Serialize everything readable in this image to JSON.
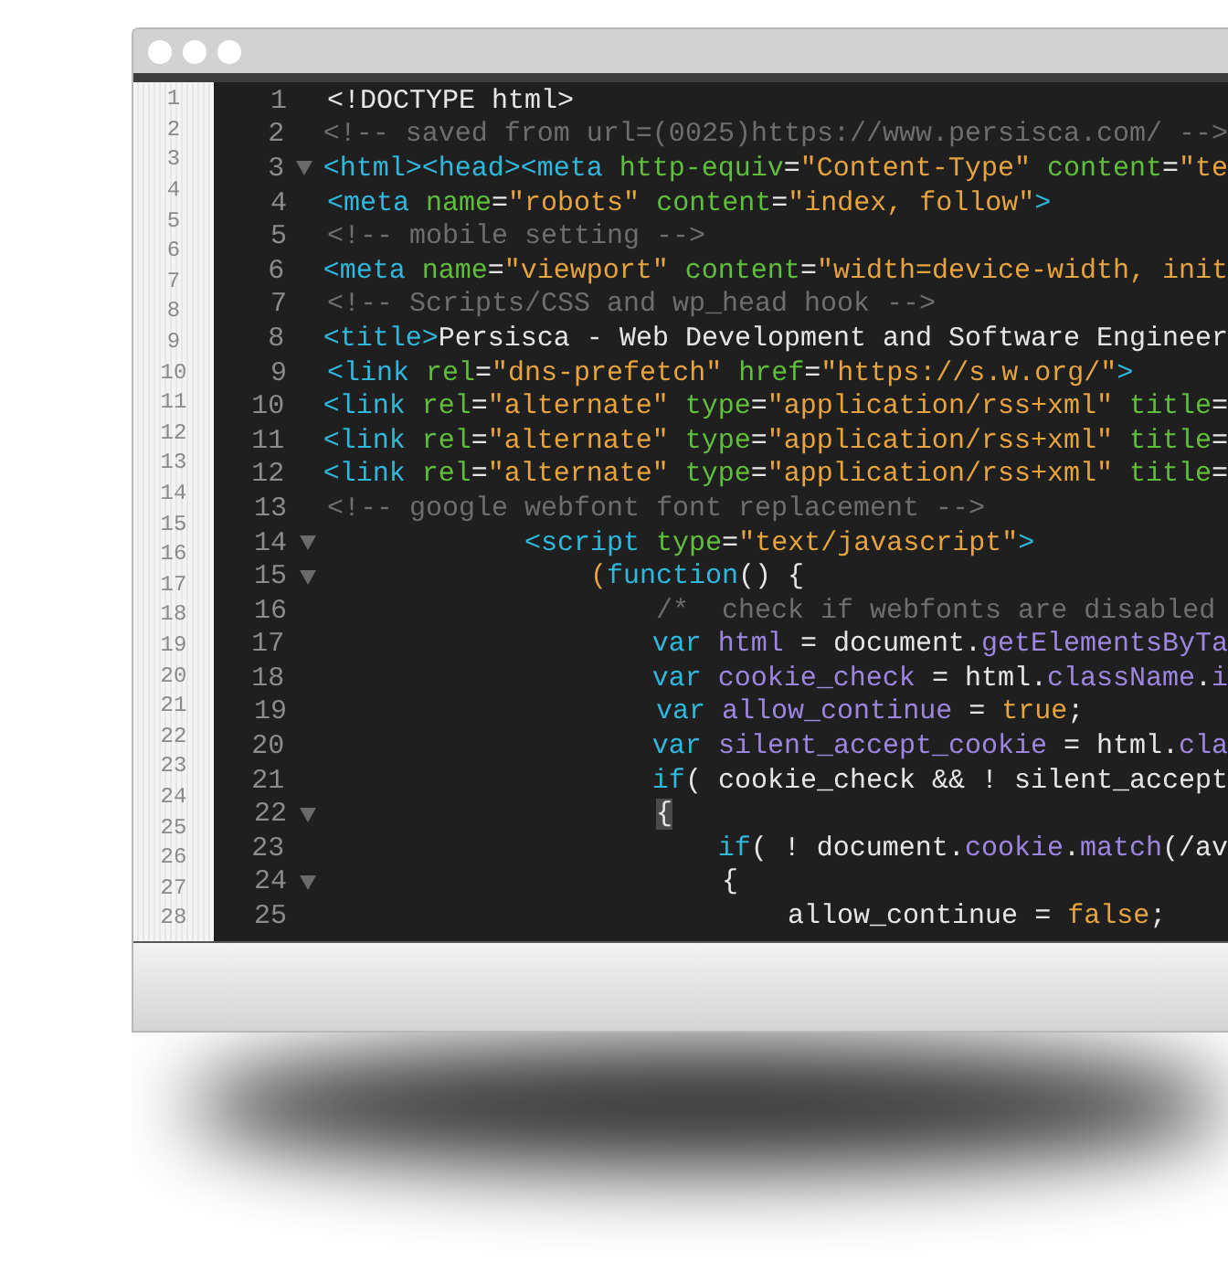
{
  "outer_gutter": {
    "line_numbers": [
      "1",
      "2",
      "3",
      "4",
      "5",
      "6",
      "7",
      "8",
      "9",
      "10",
      "11",
      "12",
      "13",
      "14",
      "15",
      "16",
      "17",
      "18",
      "19",
      "20",
      "21",
      "22",
      "23",
      "24",
      "25",
      "26",
      "27",
      "28"
    ]
  },
  "editor": {
    "lines": [
      {
        "number": "1",
        "foldable": false,
        "tokens": [
          {
            "kind": "text",
            "text": "<!DOCTYPE html>"
          }
        ]
      },
      {
        "number": "2",
        "foldable": false,
        "tokens": [
          {
            "kind": "comment",
            "text": "<!-- saved from url=(0025)https://www.persisca.com/ -->"
          }
        ]
      },
      {
        "number": "3",
        "foldable": true,
        "tokens": [
          {
            "kind": "tag",
            "text": "<html><head><meta "
          },
          {
            "kind": "attr",
            "text": "http-equiv"
          },
          {
            "kind": "text",
            "text": "="
          },
          {
            "kind": "string",
            "text": "\"Content-Type\" "
          },
          {
            "kind": "attr",
            "text": "content"
          },
          {
            "kind": "text",
            "text": "="
          },
          {
            "kind": "string",
            "text": "\"te"
          }
        ]
      },
      {
        "number": "4",
        "foldable": false,
        "tokens": [
          {
            "kind": "tag",
            "text": "<meta "
          },
          {
            "kind": "attr",
            "text": "name"
          },
          {
            "kind": "text",
            "text": "="
          },
          {
            "kind": "string",
            "text": "\"robots\" "
          },
          {
            "kind": "attr",
            "text": "content"
          },
          {
            "kind": "text",
            "text": "="
          },
          {
            "kind": "string",
            "text": "\"index, follow\""
          },
          {
            "kind": "tag",
            "text": ">"
          }
        ]
      },
      {
        "number": "5",
        "foldable": false,
        "tokens": [
          {
            "kind": "comment",
            "text": "<!-- mobile setting -->"
          }
        ]
      },
      {
        "number": "6",
        "foldable": false,
        "tokens": [
          {
            "kind": "tag",
            "text": "<meta "
          },
          {
            "kind": "attr",
            "text": "name"
          },
          {
            "kind": "text",
            "text": "="
          },
          {
            "kind": "string",
            "text": "\"viewport\" "
          },
          {
            "kind": "attr",
            "text": "content"
          },
          {
            "kind": "text",
            "text": "="
          },
          {
            "kind": "string",
            "text": "\"width=device-width, init"
          }
        ]
      },
      {
        "number": "7",
        "foldable": false,
        "tokens": [
          {
            "kind": "comment",
            "text": "<!-- Scripts/CSS and wp_head hook -->"
          }
        ]
      },
      {
        "number": "8",
        "foldable": false,
        "tokens": [
          {
            "kind": "tag",
            "text": "<title>"
          },
          {
            "kind": "text",
            "text": "Persisca - Web Development and Software Engineer"
          }
        ]
      },
      {
        "number": "9",
        "foldable": false,
        "tokens": [
          {
            "kind": "tag",
            "text": "<link "
          },
          {
            "kind": "attr",
            "text": "rel"
          },
          {
            "kind": "text",
            "text": "="
          },
          {
            "kind": "string",
            "text": "\"dns-prefetch\" "
          },
          {
            "kind": "attr",
            "text": "href"
          },
          {
            "kind": "text",
            "text": "="
          },
          {
            "kind": "string",
            "text": "\"https://s.w.org/\""
          },
          {
            "kind": "tag",
            "text": ">"
          }
        ]
      },
      {
        "number": "10",
        "foldable": false,
        "tokens": [
          {
            "kind": "tag",
            "text": "<link "
          },
          {
            "kind": "attr",
            "text": "rel"
          },
          {
            "kind": "text",
            "text": "="
          },
          {
            "kind": "string",
            "text": "\"alternate\" "
          },
          {
            "kind": "attr",
            "text": "type"
          },
          {
            "kind": "text",
            "text": "="
          },
          {
            "kind": "string",
            "text": "\"application/rss+xml\" "
          },
          {
            "kind": "attr",
            "text": "title"
          },
          {
            "kind": "text",
            "text": "="
          }
        ]
      },
      {
        "number": "11",
        "foldable": false,
        "tokens": [
          {
            "kind": "tag",
            "text": "<link "
          },
          {
            "kind": "attr",
            "text": "rel"
          },
          {
            "kind": "text",
            "text": "="
          },
          {
            "kind": "string",
            "text": "\"alternate\" "
          },
          {
            "kind": "attr",
            "text": "type"
          },
          {
            "kind": "text",
            "text": "="
          },
          {
            "kind": "string",
            "text": "\"application/rss+xml\" "
          },
          {
            "kind": "attr",
            "text": "title"
          },
          {
            "kind": "text",
            "text": "="
          }
        ]
      },
      {
        "number": "12",
        "foldable": false,
        "tokens": [
          {
            "kind": "tag",
            "text": "<link "
          },
          {
            "kind": "attr",
            "text": "rel"
          },
          {
            "kind": "text",
            "text": "="
          },
          {
            "kind": "string",
            "text": "\"alternate\" "
          },
          {
            "kind": "attr",
            "text": "type"
          },
          {
            "kind": "text",
            "text": "="
          },
          {
            "kind": "string",
            "text": "\"application/rss+xml\" "
          },
          {
            "kind": "attr",
            "text": "title"
          },
          {
            "kind": "text",
            "text": "="
          }
        ]
      },
      {
        "number": "13",
        "foldable": false,
        "tokens": [
          {
            "kind": "comment",
            "text": "<!-- google webfont font replacement -->"
          }
        ]
      },
      {
        "number": "14",
        "foldable": true,
        "tokens": [
          {
            "kind": "tag",
            "text": "            <script "
          },
          {
            "kind": "attr",
            "text": "type"
          },
          {
            "kind": "text",
            "text": "="
          },
          {
            "kind": "string",
            "text": "\"text/javascript\""
          },
          {
            "kind": "tag",
            "text": ">"
          }
        ]
      },
      {
        "number": "15",
        "foldable": true,
        "tokens": [
          {
            "kind": "string",
            "text": "                ("
          },
          {
            "kind": "keyword",
            "text": "function"
          },
          {
            "kind": "text",
            "text": "() {"
          }
        ]
      },
      {
        "number": "16",
        "foldable": false,
        "tokens": [
          {
            "kind": "comment",
            "text": "                    /*  check if webfonts are disabled"
          }
        ]
      },
      {
        "number": "17",
        "foldable": false,
        "tokens": [
          {
            "kind": "keyword",
            "text": "                    var "
          },
          {
            "kind": "ident",
            "text": "html"
          },
          {
            "kind": "text",
            "text": " = document."
          },
          {
            "kind": "ident",
            "text": "getElementsByTa"
          }
        ]
      },
      {
        "number": "18",
        "foldable": false,
        "tokens": [
          {
            "kind": "keyword",
            "text": "                    var "
          },
          {
            "kind": "ident",
            "text": "cookie_check"
          },
          {
            "kind": "text",
            "text": " = html."
          },
          {
            "kind": "ident",
            "text": "className"
          },
          {
            "kind": "text",
            "text": "."
          },
          {
            "kind": "ident",
            "text": "i"
          }
        ]
      },
      {
        "number": "19",
        "foldable": false,
        "tokens": [
          {
            "kind": "keyword",
            "text": "                    var "
          },
          {
            "kind": "ident",
            "text": "allow_continue"
          },
          {
            "kind": "text",
            "text": " = "
          },
          {
            "kind": "string",
            "text": "true"
          },
          {
            "kind": "text",
            "text": ";"
          }
        ]
      },
      {
        "number": "20",
        "foldable": false,
        "tokens": [
          {
            "kind": "keyword",
            "text": "                    var "
          },
          {
            "kind": "ident",
            "text": "silent_accept_cookie"
          },
          {
            "kind": "text",
            "text": " = html."
          },
          {
            "kind": "ident",
            "text": "cla"
          }
        ]
      },
      {
        "number": "21",
        "foldable": false,
        "tokens": [
          {
            "kind": "keyword",
            "text": "                    if"
          },
          {
            "kind": "text",
            "text": "( cookie_check && ! silent_accept"
          }
        ]
      },
      {
        "number": "22",
        "foldable": true,
        "tokens": [
          {
            "kind": "bracket",
            "text": "                    {"
          }
        ]
      },
      {
        "number": "23",
        "foldable": false,
        "tokens": [
          {
            "kind": "keyword",
            "text": "                        if"
          },
          {
            "kind": "text",
            "text": "( ! document."
          },
          {
            "kind": "ident",
            "text": "cookie"
          },
          {
            "kind": "text",
            "text": "."
          },
          {
            "kind": "ident",
            "text": "match"
          },
          {
            "kind": "text",
            "text": "(/av"
          }
        ]
      },
      {
        "number": "24",
        "foldable": true,
        "tokens": [
          {
            "kind": "text",
            "text": "                        {"
          }
        ]
      },
      {
        "number": "25",
        "foldable": false,
        "tokens": [
          {
            "kind": "text",
            "text": "                            allow_continue = "
          },
          {
            "kind": "string",
            "text": "false"
          },
          {
            "kind": "text",
            "text": ";"
          }
        ]
      }
    ]
  }
}
